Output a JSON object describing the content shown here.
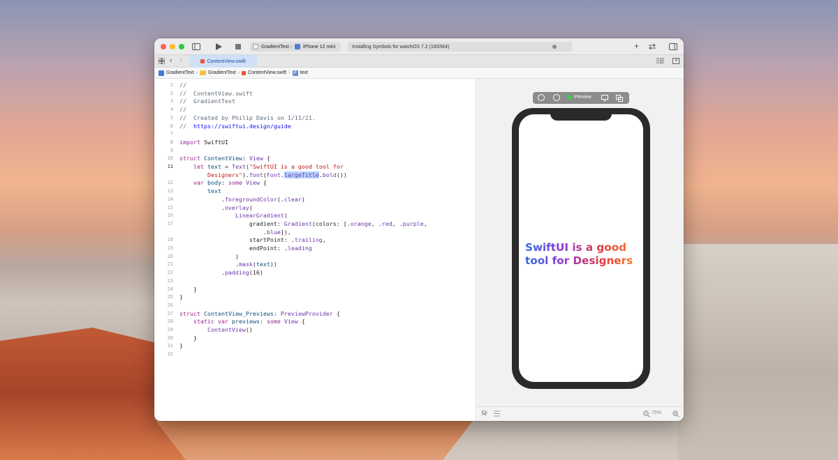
{
  "toolbar": {
    "scheme_target": "GradientText",
    "device": "iPhone 12 mini",
    "activity_status": "Installing Symbols for watchOS 7.2 (18S564)",
    "icons": [
      "sidebar-icon",
      "run-icon",
      "stop-icon",
      "add-icon",
      "swap-icon",
      "inspector-icon"
    ]
  },
  "tab": {
    "label": "ContentView.swift"
  },
  "jumpbar": {
    "items": [
      "GradientText",
      "GradientText",
      "ContentView.swift",
      "text"
    ]
  },
  "editor": {
    "current_line": 11,
    "lines": [
      {
        "n": "1",
        "segs": [
          {
            "t": "//",
            "c": "cm"
          }
        ]
      },
      {
        "n": "2",
        "segs": [
          {
            "t": "//  ContentView.swift",
            "c": "cm"
          }
        ]
      },
      {
        "n": "3",
        "segs": [
          {
            "t": "//  GradientText",
            "c": "cm"
          }
        ]
      },
      {
        "n": "4",
        "segs": [
          {
            "t": "//",
            "c": "cm"
          }
        ]
      },
      {
        "n": "5",
        "segs": [
          {
            "t": "//  Created by Philip Davis on 1/11/21.",
            "c": "cm"
          }
        ]
      },
      {
        "n": "6",
        "segs": [
          {
            "t": "//  ",
            "c": "cm"
          },
          {
            "t": "https://swiftui.design/guide",
            "c": "lk"
          }
        ]
      },
      {
        "n": "7",
        "segs": []
      },
      {
        "n": "8",
        "segs": [
          {
            "t": "import",
            "c": "kw"
          },
          {
            "t": " SwiftUI",
            "c": ""
          }
        ]
      },
      {
        "n": "9",
        "segs": []
      },
      {
        "n": "10",
        "segs": [
          {
            "t": "struct",
            "c": "kw"
          },
          {
            "t": " ",
            "c": ""
          },
          {
            "t": "ContentView",
            "c": "ty"
          },
          {
            "t": ": ",
            "c": ""
          },
          {
            "t": "View",
            "c": "fn"
          },
          {
            "t": " {",
            "c": ""
          }
        ]
      },
      {
        "n": "11",
        "segs": [
          {
            "t": "    ",
            "c": ""
          },
          {
            "t": "let",
            "c": "kw"
          },
          {
            "t": " ",
            "c": ""
          },
          {
            "t": "text",
            "c": "ty"
          },
          {
            "t": " = ",
            "c": ""
          },
          {
            "t": "Text",
            "c": "fn"
          },
          {
            "t": "(",
            "c": ""
          },
          {
            "t": "\"SwiftUI is a good tool for",
            "c": "st"
          }
        ]
      },
      {
        "n": "",
        "segs": [
          {
            "t": "        ",
            "c": ""
          },
          {
            "t": "Designers\"",
            "c": "st"
          },
          {
            "t": ").",
            "c": ""
          },
          {
            "t": "font",
            "c": "fn"
          },
          {
            "t": "(",
            "c": ""
          },
          {
            "t": "Font",
            "c": "fn"
          },
          {
            "t": ".",
            "c": ""
          },
          {
            "t": "largeTitle",
            "c": "fn hl"
          },
          {
            "t": ".",
            "c": ""
          },
          {
            "t": "bold",
            "c": "fn"
          },
          {
            "t": "())",
            "c": ""
          }
        ]
      },
      {
        "n": "12",
        "segs": [
          {
            "t": "    ",
            "c": ""
          },
          {
            "t": "var",
            "c": "kw"
          },
          {
            "t": " ",
            "c": ""
          },
          {
            "t": "body",
            "c": "ty"
          },
          {
            "t": ": ",
            "c": ""
          },
          {
            "t": "some",
            "c": "kw"
          },
          {
            "t": " ",
            "c": ""
          },
          {
            "t": "View",
            "c": "fn"
          },
          {
            "t": " {",
            "c": ""
          }
        ]
      },
      {
        "n": "13",
        "segs": [
          {
            "t": "        ",
            "c": ""
          },
          {
            "t": "text",
            "c": "ty"
          }
        ]
      },
      {
        "n": "14",
        "segs": [
          {
            "t": "            .",
            "c": ""
          },
          {
            "t": "foregroundColor",
            "c": "fn"
          },
          {
            "t": "(.",
            "c": ""
          },
          {
            "t": "clear",
            "c": "fn"
          },
          {
            "t": ")",
            "c": ""
          }
        ]
      },
      {
        "n": "15",
        "segs": [
          {
            "t": "            .",
            "c": ""
          },
          {
            "t": "overlay",
            "c": "fn"
          },
          {
            "t": "(",
            "c": ""
          }
        ]
      },
      {
        "n": "16",
        "segs": [
          {
            "t": "                ",
            "c": ""
          },
          {
            "t": "LinearGradient",
            "c": "fn"
          },
          {
            "t": "(",
            "c": ""
          }
        ]
      },
      {
        "n": "17",
        "segs": [
          {
            "t": "                    gradient: ",
            "c": ""
          },
          {
            "t": "Gradient",
            "c": "fn"
          },
          {
            "t": "(colors: [.",
            "c": ""
          },
          {
            "t": "orange",
            "c": "fn"
          },
          {
            "t": ", .",
            "c": ""
          },
          {
            "t": "red",
            "c": "fn"
          },
          {
            "t": ", .",
            "c": ""
          },
          {
            "t": "purple",
            "c": "fn"
          },
          {
            "t": ",",
            "c": ""
          }
        ]
      },
      {
        "n": "",
        "segs": [
          {
            "t": "                        .",
            "c": ""
          },
          {
            "t": "blue",
            "c": "fn"
          },
          {
            "t": "]),",
            "c": ""
          }
        ]
      },
      {
        "n": "18",
        "segs": [
          {
            "t": "                    startPoint: .",
            "c": ""
          },
          {
            "t": "trailing",
            "c": "fn"
          },
          {
            "t": ",",
            "c": ""
          }
        ]
      },
      {
        "n": "19",
        "segs": [
          {
            "t": "                    endPoint: .",
            "c": ""
          },
          {
            "t": "leading",
            "c": "fn"
          }
        ]
      },
      {
        "n": "20",
        "segs": [
          {
            "t": "                )",
            "c": ""
          }
        ]
      },
      {
        "n": "21",
        "segs": [
          {
            "t": "                .",
            "c": ""
          },
          {
            "t": "mask",
            "c": "fn"
          },
          {
            "t": "(",
            "c": ""
          },
          {
            "t": "text",
            "c": "ty"
          },
          {
            "t": "))",
            "c": ""
          }
        ]
      },
      {
        "n": "22",
        "segs": [
          {
            "t": "            .",
            "c": ""
          },
          {
            "t": "padding",
            "c": "fn"
          },
          {
            "t": "(16)",
            "c": ""
          }
        ]
      },
      {
        "n": "23",
        "segs": []
      },
      {
        "n": "24",
        "segs": [
          {
            "t": "    }",
            "c": ""
          }
        ]
      },
      {
        "n": "25",
        "segs": [
          {
            "t": "}",
            "c": ""
          }
        ]
      },
      {
        "n": "26",
        "segs": []
      },
      {
        "n": "27",
        "segs": [
          {
            "t": "struct",
            "c": "kw"
          },
          {
            "t": " ",
            "c": ""
          },
          {
            "t": "ContentView_Previews",
            "c": "ty"
          },
          {
            "t": ": ",
            "c": ""
          },
          {
            "t": "PreviewProvider",
            "c": "fn"
          },
          {
            "t": " {",
            "c": ""
          }
        ]
      },
      {
        "n": "28",
        "segs": [
          {
            "t": "    ",
            "c": ""
          },
          {
            "t": "static",
            "c": "kw"
          },
          {
            "t": " ",
            "c": ""
          },
          {
            "t": "var",
            "c": "kw"
          },
          {
            "t": " ",
            "c": ""
          },
          {
            "t": "previews",
            "c": "ty"
          },
          {
            "t": ": ",
            "c": ""
          },
          {
            "t": "some",
            "c": "kw"
          },
          {
            "t": " ",
            "c": ""
          },
          {
            "t": "View",
            "c": "fn"
          },
          {
            "t": " {",
            "c": ""
          }
        ]
      },
      {
        "n": "29",
        "segs": [
          {
            "t": "        ",
            "c": ""
          },
          {
            "t": "ContentView",
            "c": "fn"
          },
          {
            "t": "()",
            "c": ""
          }
        ]
      },
      {
        "n": "30",
        "segs": [
          {
            "t": "    }",
            "c": ""
          }
        ]
      },
      {
        "n": "31",
        "segs": [
          {
            "t": "}",
            "c": ""
          }
        ]
      },
      {
        "n": "32",
        "segs": []
      }
    ]
  },
  "canvas": {
    "preview_label": "Preview",
    "preview_text": "SwiftUI is a good tool for Designers",
    "zoom": "75%",
    "gradient_colors": [
      "#f7931e",
      "#e4393f",
      "#8f3ad0",
      "#2f6de0"
    ]
  },
  "colors": {
    "traffic_close": "#fe5f57",
    "traffic_minimize": "#febc2e",
    "traffic_zoom": "#28c840",
    "tab_active": "#cfe0f7"
  }
}
